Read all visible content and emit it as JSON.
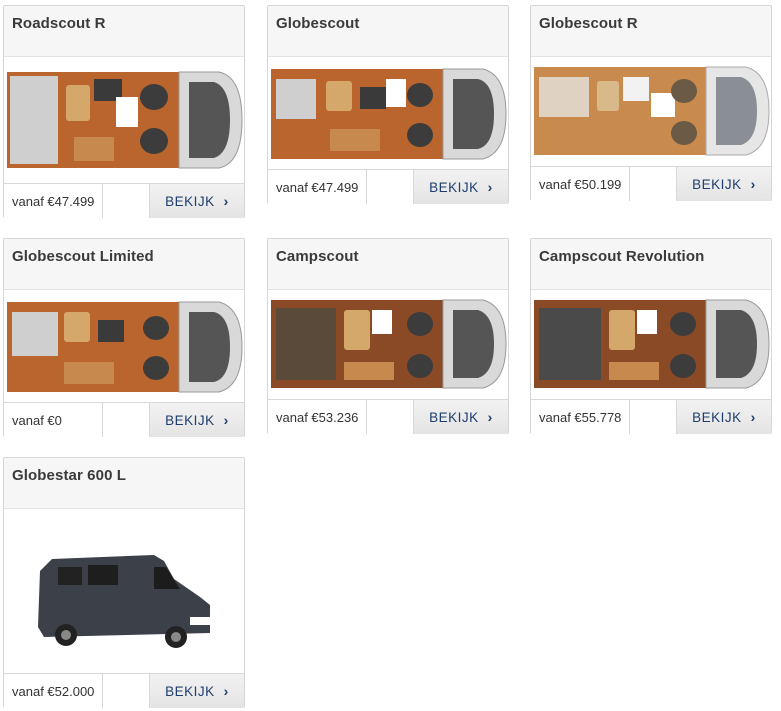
{
  "cards": [
    {
      "title": "Roadscout R",
      "price": "vanaf €47.499",
      "button": "BEKIJK",
      "variant": "plan-a"
    },
    {
      "title": "Globescout",
      "price": "vanaf €47.499",
      "button": "BEKIJK",
      "variant": "plan-a"
    },
    {
      "title": "Globescout R",
      "price": "vanaf €50.199",
      "button": "BEKIJK",
      "variant": "plan-light"
    },
    {
      "title": "Globescout Limited",
      "price": "vanaf €0",
      "button": "BEKIJK",
      "variant": "plan-a"
    },
    {
      "title": "Campscout",
      "price": "vanaf €53.236",
      "button": "BEKIJK",
      "variant": "plan-b"
    },
    {
      "title": "Campscout Revolution",
      "price": "vanaf €55.778",
      "button": "BEKIJK",
      "variant": "plan-b"
    },
    {
      "title": "Globestar 600 L",
      "price": "vanaf €52.000",
      "button": "BEKIJK",
      "variant": "photo"
    }
  ],
  "colors": {
    "button_text": "#1f3d6e",
    "wood": "#a0522d",
    "van_body": "#d9d9d9",
    "photo_van": "#3b4049"
  },
  "icons": {
    "button_chevron": "chevron-right-icon"
  }
}
